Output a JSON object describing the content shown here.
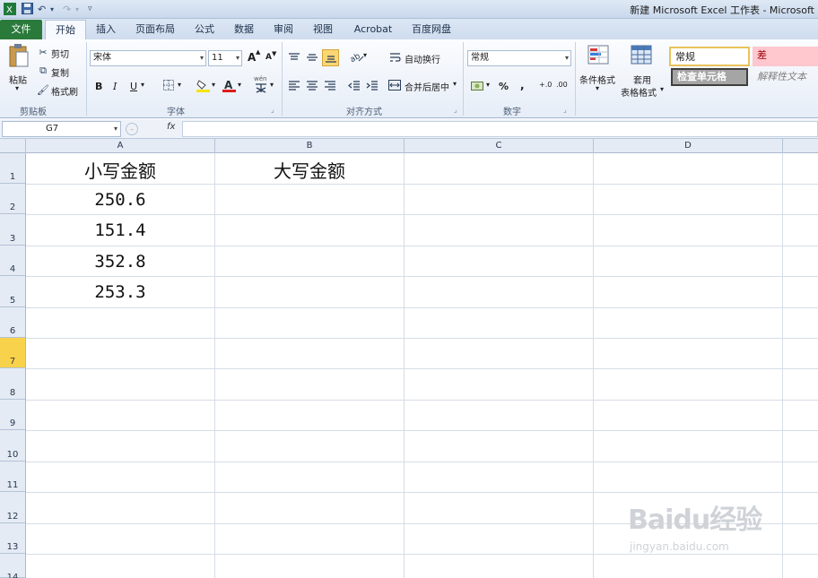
{
  "window": {
    "title": "新建 Microsoft Excel 工作表 - Microsoft"
  },
  "quick_access": {
    "app_icon": "excel-icon",
    "save_icon": "save-icon",
    "undo_icon": "undo-icon",
    "redo_icon": "redo-icon",
    "customize_icon": "chevron-down-icon"
  },
  "tabs": {
    "file": "文件",
    "items": [
      "开始",
      "插入",
      "页面布局",
      "公式",
      "数据",
      "审阅",
      "视图",
      "Acrobat",
      "百度网盘"
    ],
    "active": "开始"
  },
  "ribbon": {
    "clipboard": {
      "paste": "粘贴",
      "cut": "剪切",
      "copy": "复制",
      "format_painter": "格式刷",
      "label": "剪贴板"
    },
    "font": {
      "name": "宋体",
      "size": "11",
      "bold": "B",
      "italic": "I",
      "underline": "U",
      "grow": "A",
      "shrink": "A",
      "phonetic": "wén",
      "label": "字体"
    },
    "alignment": {
      "wrap_text": "自动换行",
      "merge_center": "合并后居中",
      "label": "对齐方式"
    },
    "number": {
      "format": "常规",
      "percent": "%",
      "comma": ",",
      "increase_decimal": "+.0",
      "decrease_decimal": ".00",
      "label": "数字"
    },
    "styles": {
      "conditional_formatting": "条件格式",
      "format_as_table_1": "套用",
      "format_as_table_2": "表格格式",
      "normal": "常规",
      "bad": "差",
      "check_cell": "检查单元格",
      "explanatory": "解释性文本"
    }
  },
  "formula_bar": {
    "name_box": "G7",
    "fx": "fx",
    "formula": ""
  },
  "sheet": {
    "columns": [
      "A",
      "B",
      "C",
      "D"
    ],
    "rows": [
      "1",
      "2",
      "3",
      "4",
      "5",
      "6",
      "7",
      "8",
      "9",
      "10",
      "11",
      "12",
      "13",
      "14"
    ],
    "selected_row": "7",
    "cells": {
      "A1": "小写金额",
      "B1": "大写金额",
      "A2": "250.6",
      "A3": "151.4",
      "A4": "352.8",
      "A5": "253.3"
    }
  },
  "watermark": {
    "logo": "Baidu经验",
    "url": "jingyan.baidu.com"
  }
}
